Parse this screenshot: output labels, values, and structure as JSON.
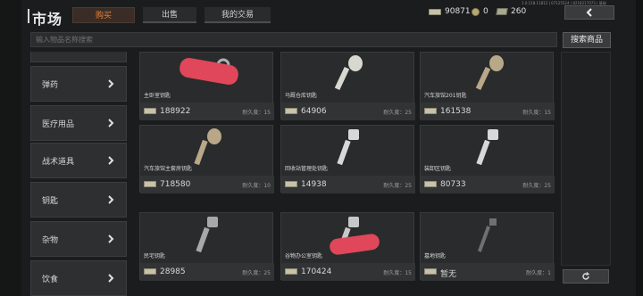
{
  "header": {
    "title": "市场",
    "tabs": [
      {
        "label": "购买",
        "active": true
      },
      {
        "label": "出售",
        "active": false
      },
      {
        "label": "我的交易",
        "active": false
      }
    ],
    "currencies": [
      {
        "icon": "cash-icon",
        "value": "90871"
      },
      {
        "icon": "coin-icon",
        "value": "0"
      },
      {
        "icon": "ticket-icon",
        "value": "260"
      }
    ],
    "version_text": "1.0.118.11812 | 07125524 | 8218217073 | 基础",
    "back_icon": "back-arrow-icon"
  },
  "search": {
    "placeholder": "输入物品名称搜索",
    "button_label": "搜索商品"
  },
  "sidebar": {
    "items": [
      {
        "label": "弹药"
      },
      {
        "label": "医疗用品"
      },
      {
        "label": "战术道具"
      },
      {
        "label": "钥匙"
      },
      {
        "label": "杂物"
      },
      {
        "label": "饮食"
      }
    ]
  },
  "items": [
    {
      "name": "主卧室钥匙",
      "price": "188922",
      "durability": "耐久度：15",
      "key_color": "#b0b0b0"
    },
    {
      "name": "马厩仓库钥匙",
      "price": "64906",
      "durability": "耐久度：25",
      "key_color": "#d8d8d0"
    },
    {
      "name": "汽车旅馆201钥匙",
      "price": "161538",
      "durability": "耐久度：15",
      "key_color": "#b8a888"
    },
    {
      "name": "汽车旅馆主套房钥匙",
      "price": "718580",
      "durability": "耐久度：10",
      "key_color": "#b8a888"
    },
    {
      "name": "回收站管理处钥匙",
      "price": "14938",
      "durability": "耐久度：25",
      "key_color": "#d8d8d8"
    },
    {
      "name": "装卸区钥匙",
      "price": "80733",
      "durability": "耐久度：25",
      "key_color": "#d8d8d8"
    },
    {
      "name": "民宅钥匙",
      "price": "28985",
      "durability": "耐久度：25",
      "key_color": "#a8a8a8"
    },
    {
      "name": "谷物办公室钥匙",
      "price": "170424",
      "durability": "耐久度：15",
      "key_color": "#c8c8c8"
    },
    {
      "name": "墓地钥匙",
      "price": "暂无",
      "durability": "耐久度：1",
      "key_color": "#707070"
    }
  ],
  "footer": {
    "refresh_icon": "refresh-icon"
  }
}
